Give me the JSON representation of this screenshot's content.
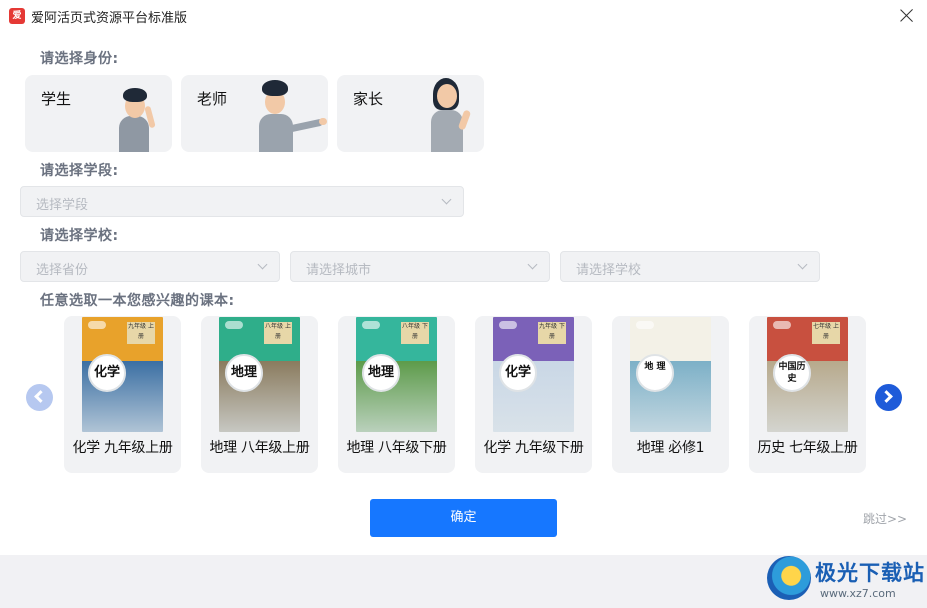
{
  "window": {
    "logo_text": "爱",
    "title": "爱阿活页式资源平台标准版"
  },
  "identity": {
    "label": "请选择身份:",
    "roles": [
      {
        "label": "学生",
        "icon": "student-figure-icon"
      },
      {
        "label": "老师",
        "icon": "teacher-figure-icon"
      },
      {
        "label": "家长",
        "icon": "parent-figure-icon"
      }
    ]
  },
  "stage": {
    "label": "请选择学段:",
    "placeholder": "选择学段"
  },
  "school": {
    "label": "请选择学校:",
    "province_placeholder": "选择省份",
    "city_placeholder": "请选择城市",
    "school_placeholder": "请选择学校"
  },
  "books": {
    "label": "任意选取一本您感兴趣的课本:",
    "items": [
      {
        "title": "化学 九年级上册",
        "badge": "化学",
        "grade": "九年级 上册",
        "band": "#e8a22b",
        "pic": "#3b6fa3"
      },
      {
        "title": "地理 八年级上册",
        "badge": "地理",
        "grade": "八年级 上册",
        "band": "#2fae8a",
        "pic": "#8a7b5e"
      },
      {
        "title": "地理 八年级下册",
        "badge": "地理",
        "grade": "八年级 下册",
        "band": "#35b69c",
        "pic": "#5d9b4a"
      },
      {
        "title": "化学 九年级下册",
        "badge": "化学",
        "grade": "九年级 下册",
        "band": "#7b61b8",
        "pic": "#c9d7e6"
      },
      {
        "title": "地理 必修1",
        "badge": "地 理",
        "grade": "",
        "band": "#f3f1e7",
        "pic": "#7cb0c7"
      },
      {
        "title": "历史 七年级上册",
        "badge": "中国历史",
        "grade": "七年级 上册",
        "band": "#c8503f",
        "pic": "#b7a98c"
      }
    ]
  },
  "nav": {
    "prev": "chevron-left-icon",
    "next": "chevron-right-icon"
  },
  "actions": {
    "confirm": "确定",
    "skip": "跳过>>"
  },
  "watermark": {
    "name": "极光下载站",
    "url": "www.xz7.com"
  }
}
